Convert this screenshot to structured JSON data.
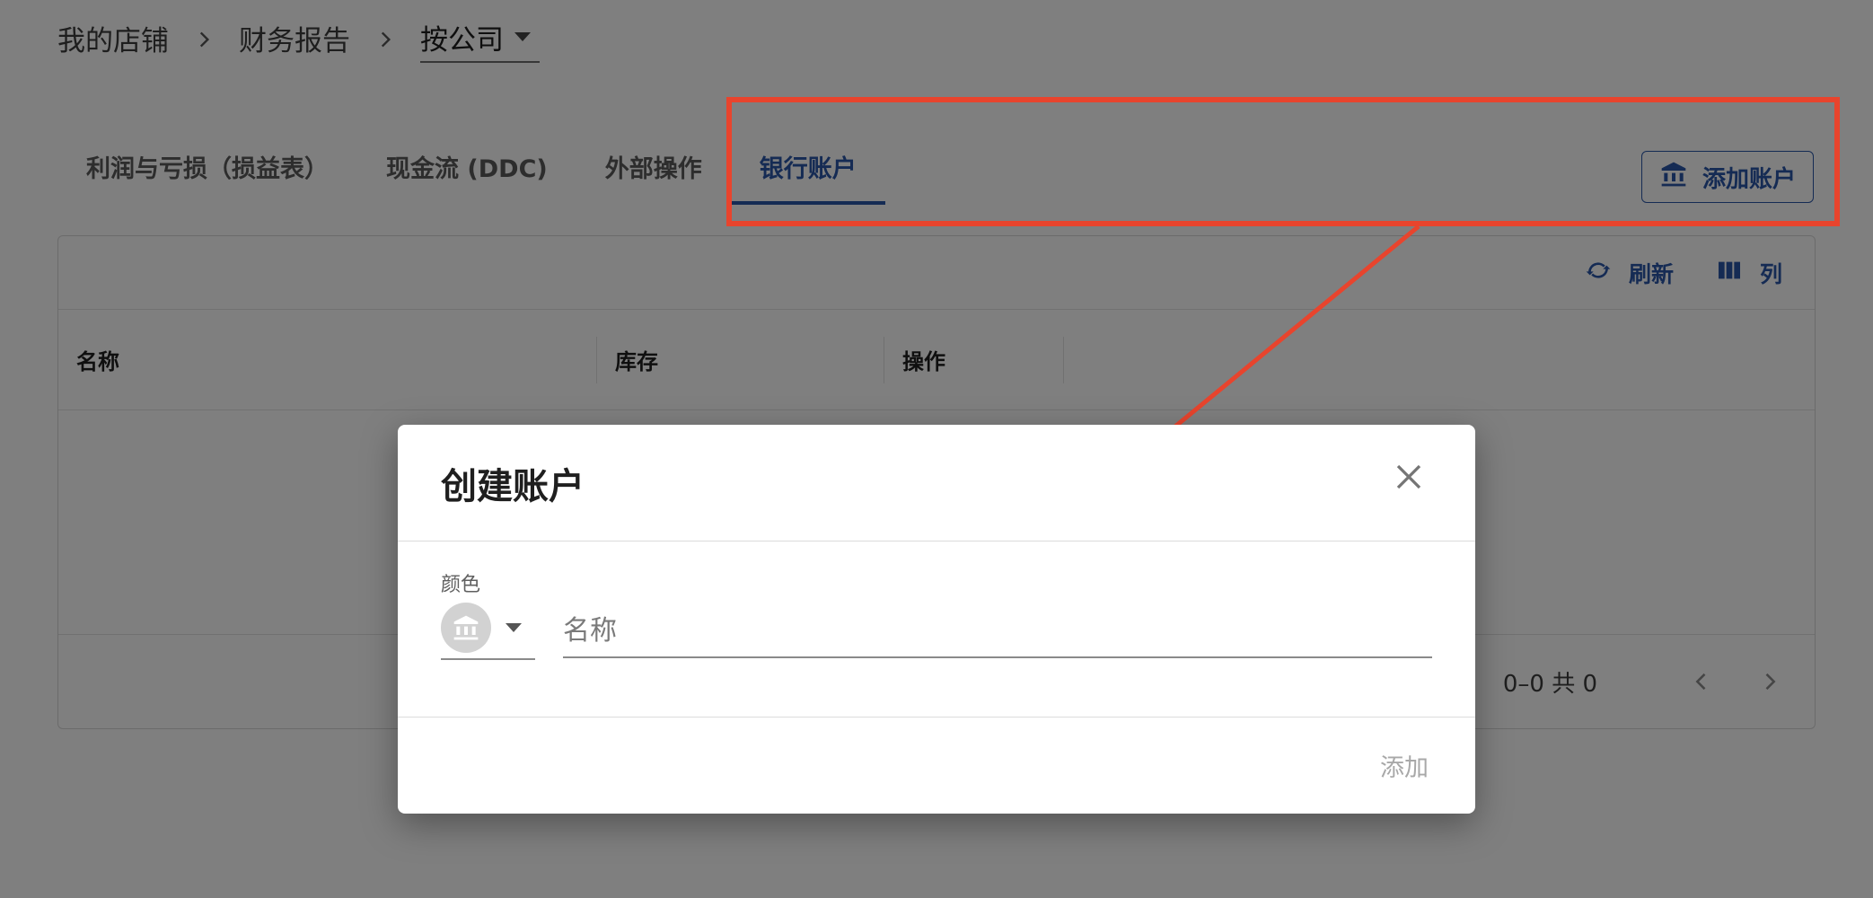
{
  "breadcrumb": {
    "items": [
      "我的店铺",
      "财务报告"
    ],
    "current": "按公司"
  },
  "tabs": [
    {
      "label": "利润与亏损（损益表）",
      "active": false
    },
    {
      "label": "现金流 (DDC)",
      "active": false
    },
    {
      "label": "外部操作",
      "active": false
    },
    {
      "label": "银行账户",
      "active": true
    }
  ],
  "add_account_label": "添加账户",
  "toolbar": {
    "refresh_label": "刷新",
    "columns_label": "列"
  },
  "table": {
    "columns": [
      "名称",
      "库存",
      "操作"
    ]
  },
  "pagination": {
    "range": "0–0 共 0"
  },
  "dialog": {
    "title": "创建账户",
    "color_label": "颜色",
    "name_placeholder": "名称",
    "name_value": "",
    "submit_label": "添加"
  },
  "colors": {
    "accent": "#2a56a8",
    "annotation": "#e8442d",
    "swatch": "#d2d2d2"
  }
}
